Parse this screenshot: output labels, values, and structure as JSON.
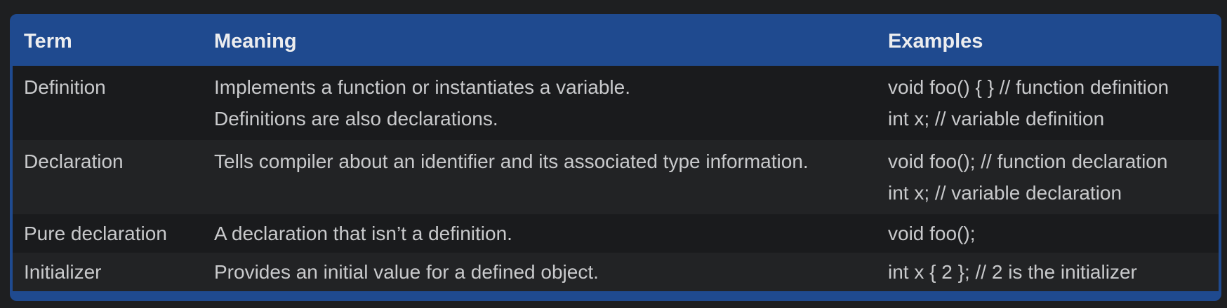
{
  "table": {
    "headers": [
      "Term",
      "Meaning",
      "Examples"
    ],
    "rows": [
      {
        "term": "Definition",
        "meaning": [
          "Implements a function or instantiates a variable.",
          "Definitions are also declarations."
        ],
        "examples": [
          "void foo() { } // function definition",
          "int x; // variable definition"
        ]
      },
      {
        "term": "Declaration",
        "meaning": [
          "Tells compiler about an identifier and its associated type information."
        ],
        "examples": [
          "void foo(); // function declaration",
          "int x; // variable declaration"
        ]
      },
      {
        "term": "Pure declaration",
        "meaning": [
          "A declaration that isn’t a definition."
        ],
        "examples": [
          "void foo();"
        ]
      },
      {
        "term": "Initializer",
        "meaning": [
          "Provides an initial value for a defined object."
        ],
        "examples": [
          "int x { 2 }; // 2 is the initializer"
        ]
      }
    ]
  },
  "colors": {
    "header_bg": "#1f4a8f",
    "page_bg": "#1e1f21",
    "row_dark": "#1a1b1d",
    "row_light": "#222325"
  }
}
